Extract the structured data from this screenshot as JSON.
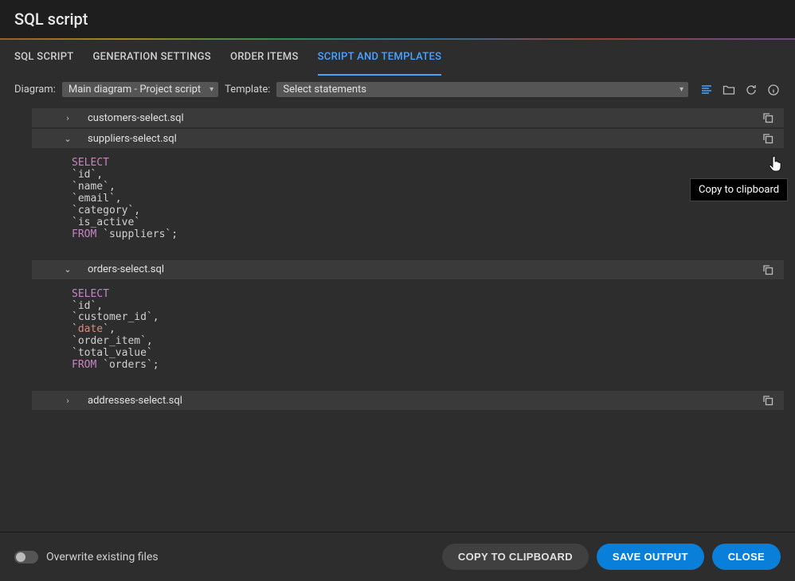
{
  "header": {
    "title": "SQL script"
  },
  "tabs": [
    {
      "label": "SQL SCRIPT",
      "active": false
    },
    {
      "label": "GENERATION SETTINGS",
      "active": false
    },
    {
      "label": "ORDER ITEMS",
      "active": false
    },
    {
      "label": "SCRIPT AND TEMPLATES",
      "active": true
    }
  ],
  "controls": {
    "diagram_label": "Diagram:",
    "diagram_value": "Main diagram - Project script",
    "template_label": "Template:",
    "template_value": "Select statements"
  },
  "files": [
    {
      "name": "customers-select.sql",
      "expanded": false
    },
    {
      "name": "suppliers-select.sql",
      "expanded": true,
      "sql": {
        "select_kw": "SELECT",
        "columns": [
          "id",
          "name",
          "email",
          "category",
          "is_active"
        ],
        "from_kw": "FROM",
        "table": "suppliers"
      }
    },
    {
      "name": "orders-select.sql",
      "expanded": true,
      "sql": {
        "select_kw": "SELECT",
        "columns": [
          "id",
          "customer_id",
          "date",
          "order_item",
          "total_value"
        ],
        "highlight_columns": [
          "date"
        ],
        "from_kw": "FROM",
        "table": "orders"
      }
    },
    {
      "name": "addresses-select.sql",
      "expanded": false
    }
  ],
  "tooltip": {
    "text": "Copy to clipboard"
  },
  "footer": {
    "toggle_label": "Overwrite existing files",
    "copy_btn": "COPY TO CLIPBOARD",
    "save_btn": "SAVE OUTPUT",
    "close_btn": "CLOSE"
  }
}
